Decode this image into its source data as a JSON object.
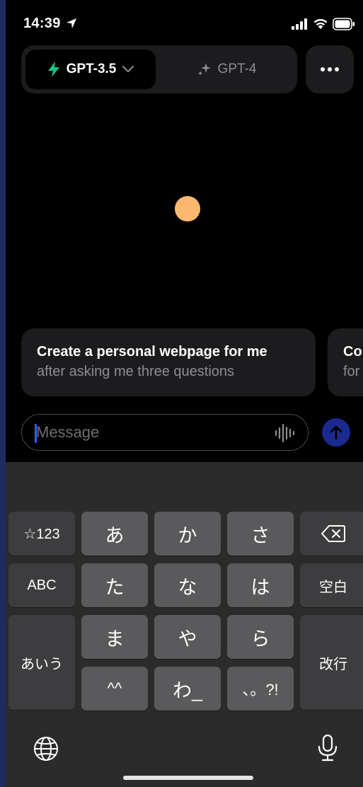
{
  "status": {
    "time": "14:39"
  },
  "header": {
    "active_model": "GPT-3.5",
    "other_model": "GPT-4",
    "accent_color": "#19c37d"
  },
  "suggestions": [
    {
      "title": "Create a personal webpage for me",
      "subtitle": "after asking me three questions"
    },
    {
      "title": "Co",
      "subtitle": "for"
    }
  ],
  "composer": {
    "placeholder": "Message"
  },
  "keyboard": {
    "rows": [
      [
        "☆123",
        "あ",
        "か",
        "さ",
        "⌫"
      ],
      [
        "ABC",
        "た",
        "な",
        "は",
        "空白"
      ],
      [
        "あいう",
        "ま",
        "や",
        "ら",
        "改行"
      ],
      [
        "^^",
        "わ_",
        "、。?!"
      ]
    ],
    "left_keys": {
      "symbols": "☆123",
      "abc": "ABC",
      "kana": "あいう"
    },
    "kana": {
      "a": "あ",
      "ka": "か",
      "sa": "さ",
      "ta": "た",
      "na": "な",
      "ha": "は",
      "ma": "ま",
      "ya": "や",
      "ra": "ら",
      "emoticon": "^^",
      "wa": "わ_",
      "punct": "、。?!"
    },
    "space": "空白",
    "return": "改行"
  }
}
